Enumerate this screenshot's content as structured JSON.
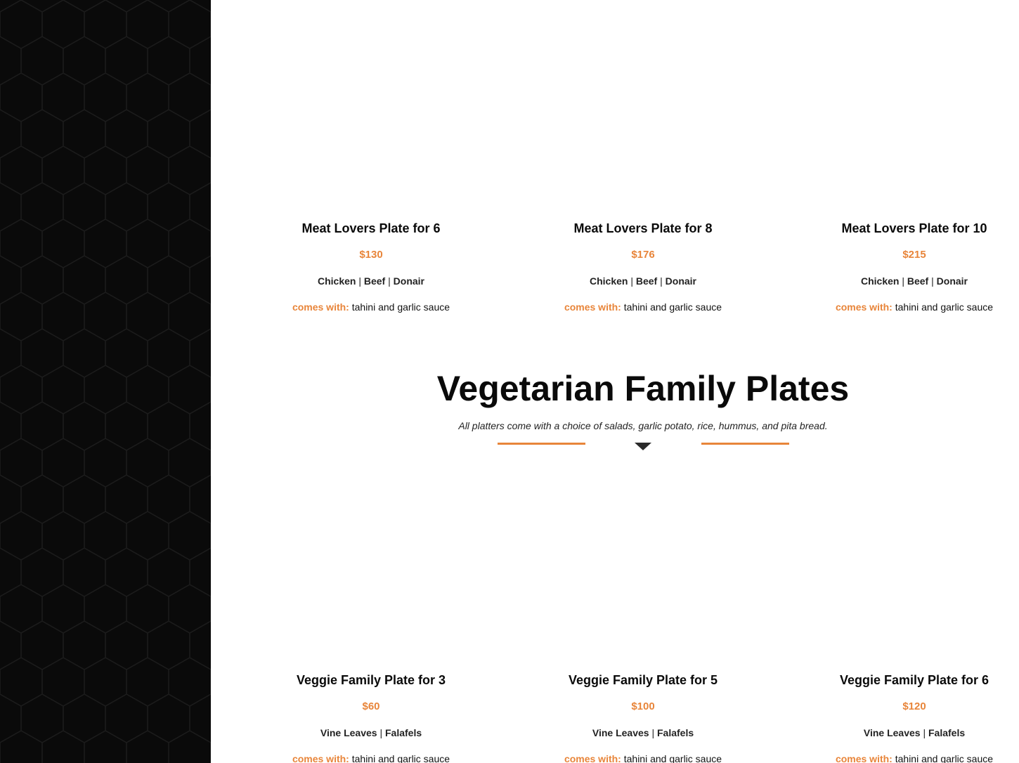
{
  "meat_plates": [
    {
      "title": "Meat Lovers Plate for 6",
      "price": "$130",
      "fillings": [
        "Chicken",
        "Beef",
        "Donair"
      ],
      "comes_label": "comes with:",
      "comes_value": "tahini and garlic sauce"
    },
    {
      "title": "Meat Lovers Plate for 8",
      "price": "$176",
      "fillings": [
        "Chicken",
        "Beef",
        "Donair"
      ],
      "comes_label": "comes with:",
      "comes_value": "tahini and garlic sauce"
    },
    {
      "title": "Meat Lovers Plate for 10",
      "price": "$215",
      "fillings": [
        "Chicken",
        "Beef",
        "Donair"
      ],
      "comes_label": "comes with:",
      "comes_value": "tahini and garlic sauce"
    }
  ],
  "veg_section": {
    "title": "Vegetarian Family Plates",
    "subtitle": "All platters come with a choice of salads, garlic potato, rice, hummus, and pita bread."
  },
  "veg_plates": [
    {
      "title": "Veggie Family Plate for 3",
      "price": "$60",
      "fillings": [
        "Vine Leaves",
        "Falafels"
      ],
      "comes_label": "comes with:",
      "comes_value": "tahini and garlic sauce"
    },
    {
      "title": "Veggie Family Plate for 5",
      "price": "$100",
      "fillings": [
        "Vine Leaves",
        "Falafels"
      ],
      "comes_label": "comes with:",
      "comes_value": "tahini and garlic sauce"
    },
    {
      "title": "Veggie Family Plate for 6",
      "price": "$120",
      "fillings": [
        "Vine Leaves",
        "Falafels"
      ],
      "comes_label": "comes with:",
      "comes_value": "tahini and garlic sauce"
    }
  ],
  "colors": {
    "accent": "#e8853a",
    "sidebar_bg": "#0a0a0a",
    "pattern_stroke": "#1c1c1c",
    "text": "#0a0a0a"
  }
}
